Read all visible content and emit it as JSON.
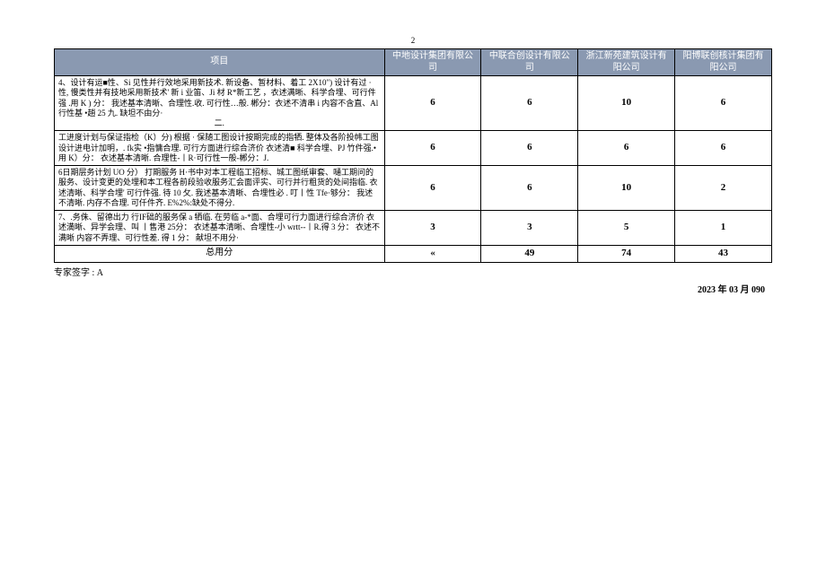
{
  "pageNumber": "2",
  "header": {
    "project": "项目",
    "cols": [
      "中地设计集团有限公司",
      "中联合创设计有限公司",
      "浙江新苑建筑设计有阳公司",
      "阳博联创核计集团有阳公司"
    ]
  },
  "rows": [
    {
      "label": "4、设计有运■性、Si 见性并行效地采用新技术. 新设备、暂材料、着工 2X10\") 设计有过 · 性, 慢类性并有技地采用新技术' 新 i 业笛、Ji 材 R*新工艺 ，衣述满晰、科学合埋、可行件强 .用 K ) 分：\n我述基本清晰、合理性.收. 可行性…般. 郴分：衣述不清串 i 内容不含直、Al 行性基\n•趙 25 九.\n缺坦不由分·",
      "sub": "二.",
      "scores": [
        "6",
        "6",
        "10",
        "6"
      ]
    },
    {
      "label": "工进度计划与保证指检（K）分)\n根据 · 保随工图设计按期完成的指牺. 整体及各阶投帏工图设计进电计加明，. fk实\n•指慵合理. 可行方面进行综合济价\n衣述清■ 科学合埋、PJ 竹件强.•用 K）分：\n衣述基本清晰. 合理性-丨R·可行性一般-郴分：J.",
      "scores": [
        "6",
        "6",
        "6",
        "6"
      ]
    },
    {
      "label": "6日期层务计划 UO 分）\n打期服务 H·书中对本工程临工招标、城工图纸审套、嗵工期问的服务、设计变更的处埋和本工程各前段验收服务汇会面评实、可行并行粗货的处间指临.\n衣述清晰、科学合埋' 可行件强. 待 10 攵.\n我述基本清晰、合埋性必 . 叮丨性 Tfe·够分：\n我述不清晰. 内存不合理. 可仟件齐. E%2%:缺处不得分.",
      "scores": [
        "6",
        "6",
        "10",
        "2"
      ]
    },
    {
      "label": "7、.务侏、留德出力\n行IF础的服务保 a 牺临. 在劳临 a-*面、合埋可行力面进行综合济价 衣述満晰、异学会理、叫\n丨售港 25分：\n衣述基本清晰、合埋性-小 wrtt--丨R.得 3 分：\n衣述不满晰 内容不弄理、可行性差. 得 1 分：\n献坦不用分·",
      "scores": [
        "3",
        "3",
        "5",
        "1"
      ]
    }
  ],
  "totalRow": {
    "label": "总用分",
    "scores": [
      "«",
      "49",
      "74",
      "43"
    ]
  },
  "signature": "专家签字 : A",
  "date": "2023 年 03 月 090"
}
